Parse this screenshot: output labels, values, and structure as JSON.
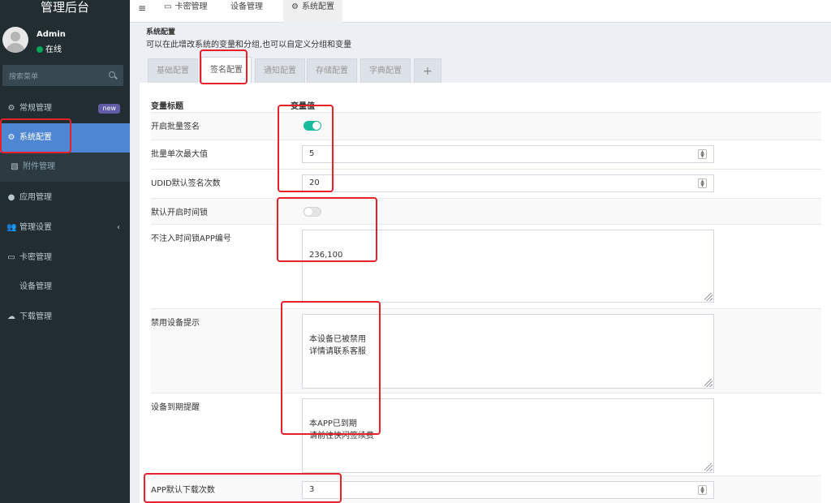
{
  "sidebar": {
    "brand": "管理后台",
    "user": {
      "name": "Admin",
      "status": "在线"
    },
    "search_placeholder": "搜索菜单",
    "items": [
      {
        "label": "常规管理",
        "icon": "cogs-icon",
        "badge": "new"
      },
      {
        "label": "系统配置",
        "icon": "gear-icon"
      },
      {
        "label": "附件管理",
        "icon": "file-image-icon"
      },
      {
        "label": "应用管理",
        "icon": "circle-icon"
      },
      {
        "label": "管理设置",
        "icon": "users-icon"
      },
      {
        "label": "卡密管理",
        "icon": "credit-card-icon"
      },
      {
        "label": "设备管理",
        "icon": "apple-icon"
      },
      {
        "label": "下载管理",
        "icon": "cloud-download-icon"
      }
    ]
  },
  "topbar": {
    "tabs": [
      {
        "label": "卡密管理",
        "icon": "credit-card-icon"
      },
      {
        "label": "设备管理",
        "icon": "apple-icon"
      },
      {
        "label": "系统配置",
        "icon": "gear-icon"
      }
    ]
  },
  "page": {
    "title": "系统配置",
    "subtitle": "可以在此增改系统的变量和分组,也可以自定义分组和变量",
    "tabs": [
      "基础配置",
      "签名配置",
      "通知配置",
      "存储配置",
      "字典配置",
      "+"
    ]
  },
  "table": {
    "col_title": "变量标题",
    "col_value": "变量值",
    "rows": [
      {
        "label": "开启批量签名",
        "type": "toggle",
        "value": "on"
      },
      {
        "label": "批量单次最大值",
        "type": "number",
        "value": "5"
      },
      {
        "label": "UDID默认签名次数",
        "type": "number",
        "value": "20"
      },
      {
        "label": "默认开启时间锁",
        "type": "toggle",
        "value": "off"
      },
      {
        "label": "不注入时间锁APP编号",
        "type": "textarea",
        "value": "236,100"
      },
      {
        "label": "禁用设备提示",
        "type": "textarea",
        "value": "本设备已被禁用\n详情请联系客服"
      },
      {
        "label": "设备到期提醒",
        "type": "textarea",
        "value": "本APP已到期\n请前往快闪签续费"
      },
      {
        "label": "APP默认下载次数",
        "type": "number",
        "value": "3"
      }
    ]
  },
  "colors": {
    "sidebar_bg": "#222d32",
    "active_menu": "#4e86d4",
    "toggle_on": "#18bc9c",
    "highlight": "#e8202a"
  }
}
